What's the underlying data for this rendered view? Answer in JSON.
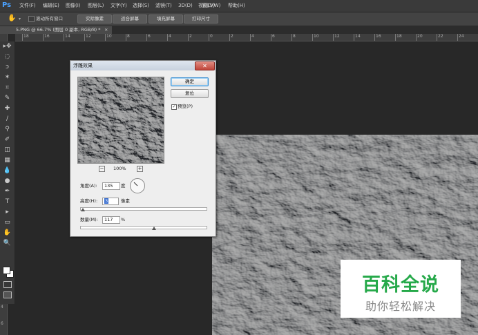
{
  "app": {
    "logo": "Ps"
  },
  "menu": [
    "文件(F)",
    "编辑(E)",
    "图像(I)",
    "图层(L)",
    "文字(Y)",
    "选择(S)",
    "滤镜(T)",
    "3D(D)",
    "视图(V)",
    "窗口(W)",
    "帮助(H)"
  ],
  "options_bar": {
    "scroll_all_label": "滚动所有窗口",
    "btn_actual_pixels": "实际像素",
    "btn_fit_screen": "适合屏幕",
    "btn_fill_screen": "填充屏幕",
    "btn_print_size": "打印尺寸"
  },
  "document": {
    "tab_label": "5.PNG @ 66.7% (图层 0 副本, RGB/8) *",
    "tab_close": "×"
  },
  "ruler": {
    "top_labels": [
      "18",
      "16",
      "14",
      "12",
      "10",
      "8",
      "6",
      "4",
      "2",
      "0",
      "2",
      "4",
      "6",
      "8",
      "10",
      "12",
      "14",
      "16",
      "18",
      "20",
      "22",
      "24"
    ],
    "left_labels": [
      "4",
      "6"
    ]
  },
  "toolbar_icons": [
    "move-icon",
    "marquee-icon",
    "lasso-icon",
    "magic-wand-icon",
    "crop-icon",
    "eyedropper-icon",
    "healing-brush-icon",
    "brush-icon",
    "clone-stamp-icon",
    "history-brush-icon",
    "eraser-icon",
    "gradient-icon",
    "blur-icon",
    "dodge-icon",
    "pen-icon",
    "type-icon",
    "path-selection-icon",
    "shape-icon",
    "hand-icon",
    "zoom-icon"
  ],
  "toolbar_glyphs": [
    "▸✥",
    "◌",
    "ↄ",
    "✶",
    "⌗",
    "✎",
    "✚",
    "∕",
    "⚲",
    "✐",
    "◫",
    "▦",
    "💧",
    "●",
    "✒",
    "T",
    "▸",
    "▭",
    "✋",
    "🔍"
  ],
  "dialog": {
    "title": "浮雕效果",
    "close": "✕",
    "ok": "确定",
    "reset": "复位",
    "preview_check": "✓",
    "preview_label": "预览(P)",
    "zoom_minus": "−",
    "zoom_plus": "+",
    "zoom_value": "100%",
    "angle_label": "角度(A):",
    "angle_value": "135",
    "angle_unit": "度",
    "height_label": "高度(H):",
    "height_value": "3",
    "height_unit": "像素",
    "amount_label": "数量(M):",
    "amount_value": "117",
    "amount_unit": "%"
  },
  "watermark": {
    "title": "百科全说",
    "subtitle": "助你轻松解决"
  },
  "colors": {
    "accent": "#4ba2ff",
    "watermark_green": "#26a94a"
  }
}
